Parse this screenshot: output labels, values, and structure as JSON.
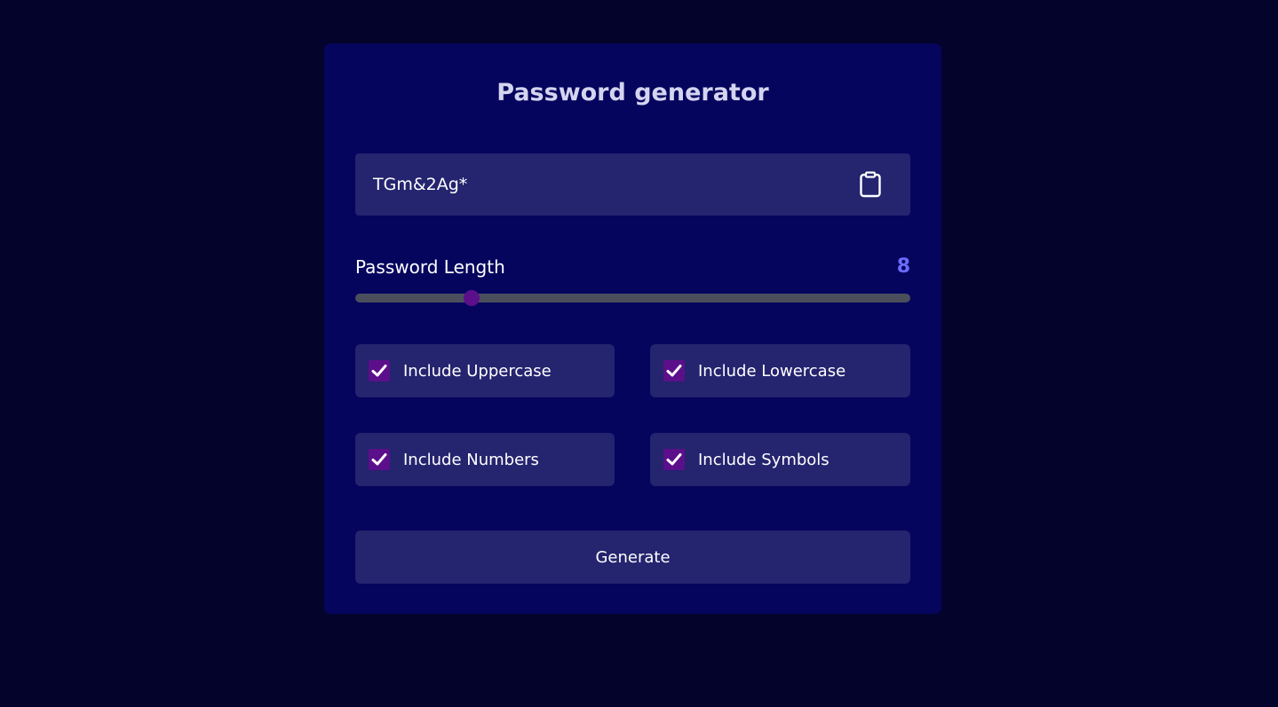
{
  "app": {
    "title": "Password generator"
  },
  "password": {
    "value": "TGm&2Ag*",
    "copy_icon": "clipboard-icon"
  },
  "length": {
    "label": "Password Length",
    "value": "8",
    "slider_fraction": 0.21
  },
  "options": [
    {
      "label": "Include Uppercase",
      "checked": true
    },
    {
      "label": "Include Lowercase",
      "checked": true
    },
    {
      "label": "Include Numbers",
      "checked": true
    },
    {
      "label": "Include Symbols",
      "checked": true
    }
  ],
  "actions": {
    "generate_label": "Generate"
  },
  "colors": {
    "background": "#03032b",
    "card": "#05055e",
    "field": "#24246f",
    "accent": "#5c0f8a",
    "length_value": "#6b6bff",
    "title": "#d4d4f0"
  }
}
